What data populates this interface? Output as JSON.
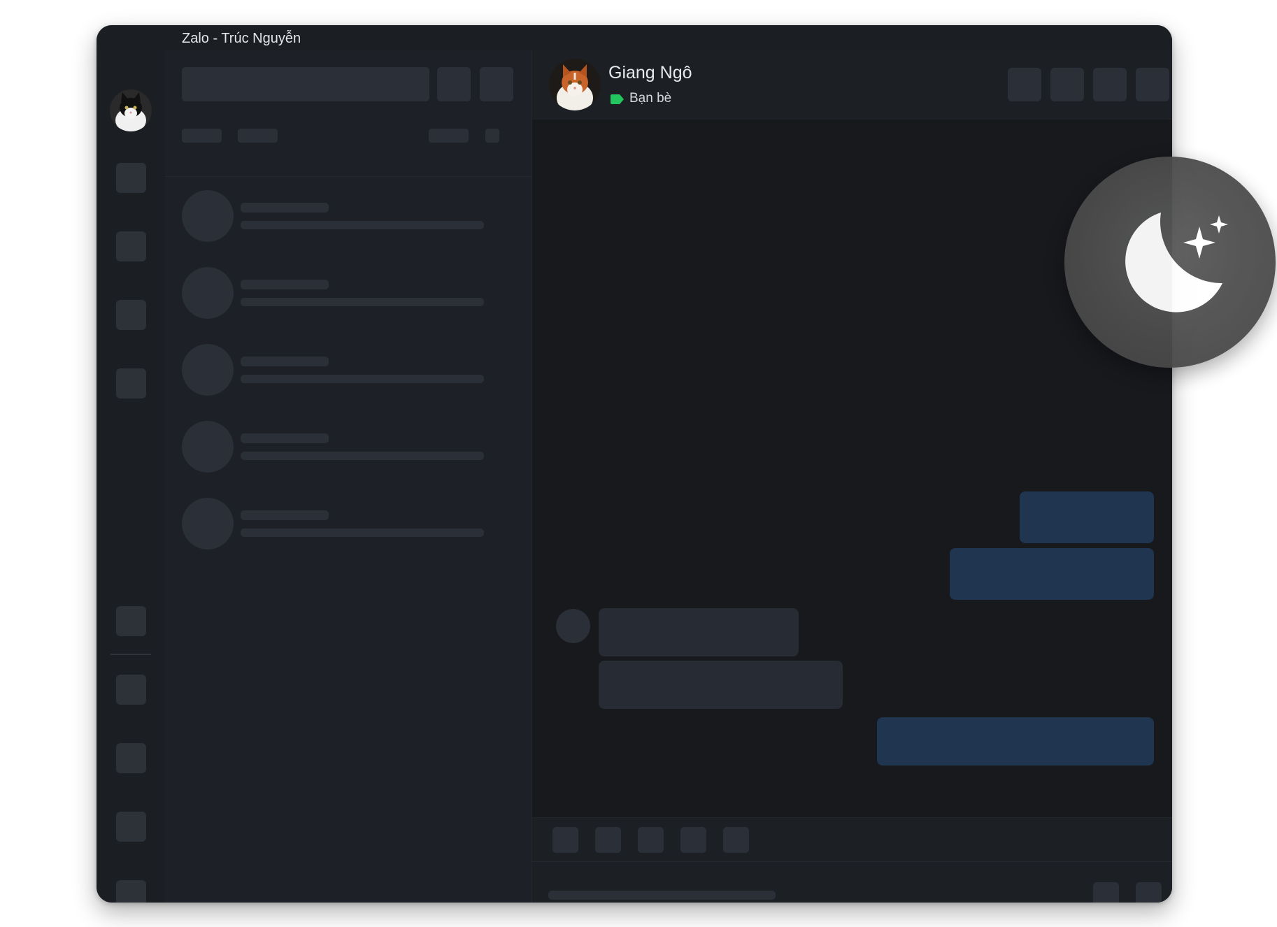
{
  "window": {
    "title": "Zalo - Trúc Nguyễn"
  },
  "chat": {
    "contact_name": "Giang Ngô",
    "contact_tag": "Bạn bè",
    "tag_color": "#22c55e"
  },
  "icons": {
    "nav_avatar": "cat-avatar-icon",
    "header_avatar": "cat-avatar-icon",
    "theme": "moon-stars-icon"
  },
  "colors": {
    "window_bg": "#1b1e23",
    "chat_bg": "#17191d",
    "outgoing_bubble": "#1f3550",
    "incoming_bubble": "#272b33",
    "placeholder": "#2b2f37"
  }
}
